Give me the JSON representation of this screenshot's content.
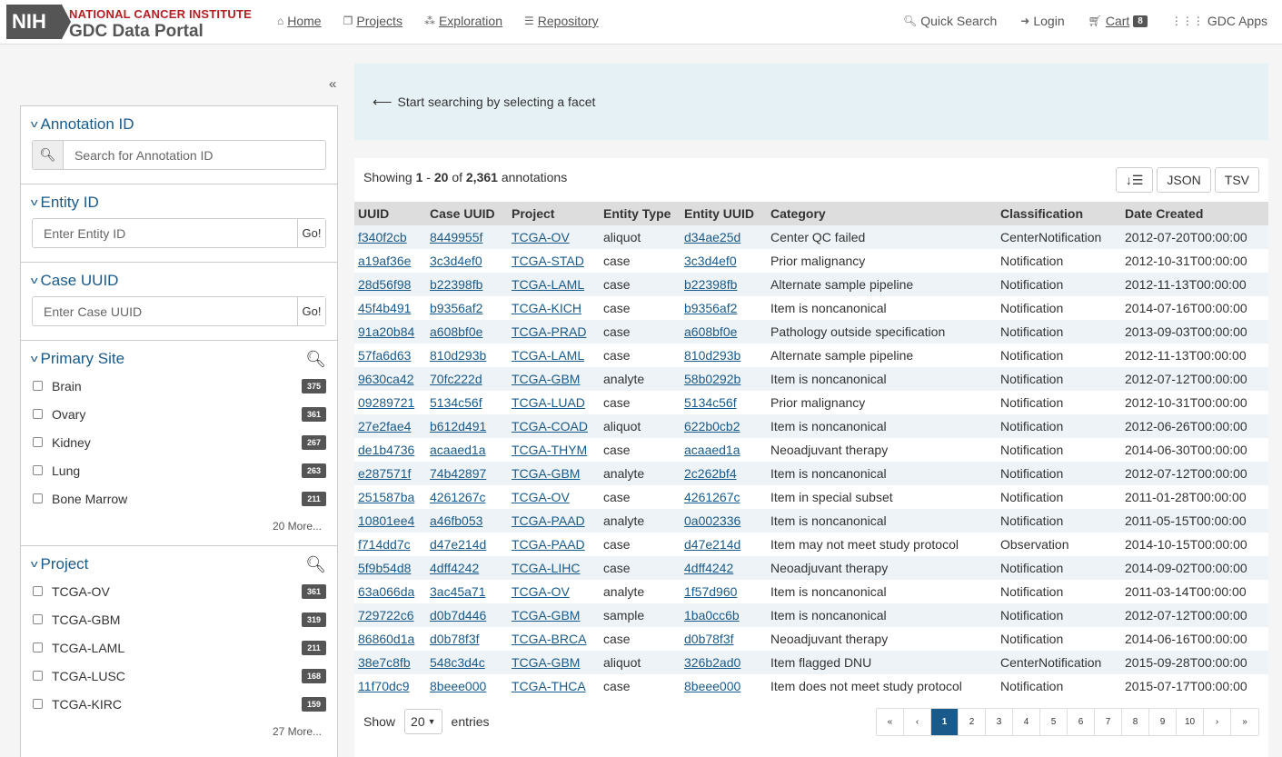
{
  "header": {
    "logo_nih": "NIH",
    "logo_line1": "NATIONAL CANCER INSTITUTE",
    "logo_line2": "GDC Data Portal",
    "nav": [
      {
        "label": "Home",
        "icon": "home-icon"
      },
      {
        "label": "Projects",
        "icon": "projects-icon"
      },
      {
        "label": "Exploration",
        "icon": "exploration-icon"
      },
      {
        "label": "Repository",
        "icon": "database-icon"
      }
    ],
    "quick_search": "Quick Search",
    "login": "Login",
    "cart": "Cart",
    "cart_count": "8",
    "gdc_apps": "GDC Apps"
  },
  "sidebar": {
    "collapse_icon": "«",
    "annotation_id": {
      "title": "Annotation ID",
      "placeholder": "Search for Annotation ID"
    },
    "entity_id": {
      "title": "Entity ID",
      "placeholder": "Enter Entity ID",
      "go": "Go!"
    },
    "case_uuid": {
      "title": "Case UUID",
      "placeholder": "Enter Case UUID",
      "go": "Go!"
    },
    "primary_site": {
      "title": "Primary Site",
      "items": [
        {
          "name": "Brain",
          "count": "375"
        },
        {
          "name": "Ovary",
          "count": "361"
        },
        {
          "name": "Kidney",
          "count": "267"
        },
        {
          "name": "Lung",
          "count": "263"
        },
        {
          "name": "Bone Marrow",
          "count": "211"
        }
      ],
      "more": "20 More..."
    },
    "project": {
      "title": "Project",
      "items": [
        {
          "name": "TCGA-OV",
          "count": "361"
        },
        {
          "name": "TCGA-GBM",
          "count": "319"
        },
        {
          "name": "TCGA-LAML",
          "count": "211"
        },
        {
          "name": "TCGA-LUSC",
          "count": "168"
        },
        {
          "name": "TCGA-KIRC",
          "count": "159"
        }
      ],
      "more": "27 More..."
    }
  },
  "banner": {
    "text": "Start searching by selecting a facet"
  },
  "results": {
    "showing_prefix": "Showing",
    "range_start": "1",
    "range_sep": "-",
    "range_end": "20",
    "of": "of",
    "total": "2,361",
    "unit": "annotations",
    "json_btn": "JSON",
    "tsv_btn": "TSV",
    "columns": [
      "UUID",
      "Case UUID",
      "Project",
      "Entity Type",
      "Entity UUID",
      "Category",
      "Classification",
      "Date Created"
    ],
    "rows": [
      [
        "f340f2cb",
        "8449955f",
        "TCGA-OV",
        "aliquot",
        "d34ae25d",
        "Center QC failed",
        "CenterNotification",
        "2012-07-20T00:00:00"
      ],
      [
        "a19af36e",
        "3c3d4ef0",
        "TCGA-STAD",
        "case",
        "3c3d4ef0",
        "Prior malignancy",
        "Notification",
        "2012-10-31T00:00:00"
      ],
      [
        "28d56f98",
        "b22398fb",
        "TCGA-LAML",
        "case",
        "b22398fb",
        "Alternate sample pipeline",
        "Notification",
        "2012-11-13T00:00:00"
      ],
      [
        "45f4b491",
        "b9356af2",
        "TCGA-KICH",
        "case",
        "b9356af2",
        "Item is noncanonical",
        "Notification",
        "2014-07-16T00:00:00"
      ],
      [
        "91a20b84",
        "a608bf0e",
        "TCGA-PRAD",
        "case",
        "a608bf0e",
        "Pathology outside specification",
        "Notification",
        "2013-09-03T00:00:00"
      ],
      [
        "57fa6d63",
        "810d293b",
        "TCGA-LAML",
        "case",
        "810d293b",
        "Alternate sample pipeline",
        "Notification",
        "2012-11-13T00:00:00"
      ],
      [
        "9630ca42",
        "70fc222d",
        "TCGA-GBM",
        "analyte",
        "58b0292b",
        "Item is noncanonical",
        "Notification",
        "2012-07-12T00:00:00"
      ],
      [
        "09289721",
        "5134c56f",
        "TCGA-LUAD",
        "case",
        "5134c56f",
        "Prior malignancy",
        "Notification",
        "2012-10-31T00:00:00"
      ],
      [
        "27e2fae4",
        "b612d491",
        "TCGA-COAD",
        "aliquot",
        "622b0cb2",
        "Item is noncanonical",
        "Notification",
        "2012-06-26T00:00:00"
      ],
      [
        "de1b4736",
        "acaaed1a",
        "TCGA-THYM",
        "case",
        "acaaed1a",
        "Neoadjuvant therapy",
        "Notification",
        "2014-06-30T00:00:00"
      ],
      [
        "e287571f",
        "74b42897",
        "TCGA-GBM",
        "analyte",
        "2c262bf4",
        "Item is noncanonical",
        "Notification",
        "2012-07-12T00:00:00"
      ],
      [
        "251587ba",
        "4261267c",
        "TCGA-OV",
        "case",
        "4261267c",
        "Item in special subset",
        "Notification",
        "2011-01-28T00:00:00"
      ],
      [
        "10801ee4",
        "a46fb053",
        "TCGA-PAAD",
        "analyte",
        "0a002336",
        "Item is noncanonical",
        "Notification",
        "2011-05-15T00:00:00"
      ],
      [
        "f714dd7c",
        "d47e214d",
        "TCGA-PAAD",
        "case",
        "d47e214d",
        "Item may not meet study protocol",
        "Observation",
        "2014-10-15T00:00:00"
      ],
      [
        "5f9b54d8",
        "4dff4242",
        "TCGA-LIHC",
        "case",
        "4dff4242",
        "Neoadjuvant therapy",
        "Notification",
        "2014-09-02T00:00:00"
      ],
      [
        "63a066da",
        "3ac45a71",
        "TCGA-OV",
        "analyte",
        "1f57d960",
        "Item is noncanonical",
        "Notification",
        "2011-03-14T00:00:00"
      ],
      [
        "729722c6",
        "d0b7d446",
        "TCGA-GBM",
        "sample",
        "1ba0cc6b",
        "Item is noncanonical",
        "Notification",
        "2012-07-12T00:00:00"
      ],
      [
        "86860d1a",
        "d0b78f3f",
        "TCGA-BRCA",
        "case",
        "d0b78f3f",
        "Neoadjuvant therapy",
        "Notification",
        "2014-06-16T00:00:00"
      ],
      [
        "38e7c8fb",
        "548c3d4c",
        "TCGA-GBM",
        "aliquot",
        "326b2ad0",
        "Item flagged DNU",
        "CenterNotification",
        "2015-09-28T00:00:00"
      ],
      [
        "11f70dc9",
        "8beee000",
        "TCGA-THCA",
        "case",
        "8beee000",
        "Item does not meet study protocol",
        "Notification",
        "2015-07-17T00:00:00"
      ]
    ]
  },
  "footer": {
    "show": "Show",
    "page_size": "20",
    "entries": "entries",
    "pages": [
      "«",
      "‹",
      "1",
      "2",
      "3",
      "4",
      "5",
      "6",
      "7",
      "8",
      "9",
      "10",
      "›",
      "»"
    ],
    "active_page": "1"
  },
  "colors": {
    "link": "#1a5a8a",
    "nih_red": "#b41f24",
    "banner_bg": "#e6f1f6"
  }
}
